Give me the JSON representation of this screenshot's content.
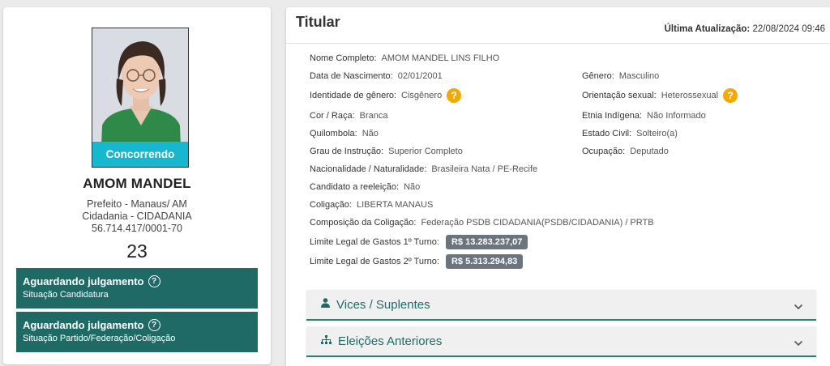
{
  "candidate": {
    "status_badge": "Concorrendo",
    "name": "AMOM MANDEL",
    "office": "Prefeito - Manaus/ AM",
    "party": "Cidadania - CIDADANIA",
    "cnpj": "56.714.417/0001-70",
    "number": "23"
  },
  "status_boxes": [
    {
      "title": "Aguardando julgamento",
      "subtitle": "Situação Candidatura"
    },
    {
      "title": "Aguardando julgamento",
      "subtitle": "Situação Partido/Federação/Coligação"
    }
  ],
  "panel": {
    "title": "Titular",
    "update_label": "Última Atualização:",
    "update_value": "22/08/2024 09:46"
  },
  "fields": {
    "nome_completo": {
      "label": "Nome Completo:",
      "value": "AMOM MANDEL LINS FILHO"
    },
    "data_nascimento": {
      "label": "Data de Nascimento:",
      "value": "02/01/2001"
    },
    "genero": {
      "label": "Gênero:",
      "value": "Masculino"
    },
    "identidade_genero": {
      "label": "Identidade de gênero:",
      "value": "Cisgênero"
    },
    "orientacao_sexual": {
      "label": "Orientação sexual:",
      "value": "Heterossexual"
    },
    "cor_raca": {
      "label": "Cor / Raça:",
      "value": "Branca"
    },
    "etnia_indigena": {
      "label": "Etnia Indígena:",
      "value": "Não Informado"
    },
    "quilombola": {
      "label": "Quilombola:",
      "value": "Não"
    },
    "estado_civil": {
      "label": "Estado Civil:",
      "value": "Solteiro(a)"
    },
    "grau_instrucao": {
      "label": "Grau de Instrução:",
      "value": "Superior Completo"
    },
    "ocupacao": {
      "label": "Ocupação:",
      "value": "Deputado"
    },
    "nacionalidade": {
      "label": "Nacionalidade / Naturalidade:",
      "value": "Brasileira Nata / PE-Recife"
    },
    "reeleicao": {
      "label": "Candidato a reeleição:",
      "value": "Não"
    },
    "coligacao": {
      "label": "Coligação:",
      "value": "LIBERTA MANAUS"
    },
    "composicao": {
      "label": "Composição da Coligação:",
      "value": "Federação PSDB CIDADANIA(PSDB/CIDADANIA) / PRTB"
    },
    "limite_1turno": {
      "label": "Limite Legal de Gastos 1º Turno:",
      "value": "R$ 13.283.237,07"
    },
    "limite_2turno": {
      "label": "Limite Legal de Gastos 2º Turno:",
      "value": "R$ 5.313.294,83"
    }
  },
  "help_icon": "?",
  "accordions": [
    {
      "label": "Vices / Suplentes",
      "icon": "person-icon"
    },
    {
      "label": "Eleições Anteriores",
      "icon": "sitemap-icon"
    }
  ],
  "colors": {
    "accent_teal": "#206a66",
    "badge_cyan": "#17b8cf",
    "help_orange": "#f2a900",
    "money_gray": "#6c757d"
  }
}
